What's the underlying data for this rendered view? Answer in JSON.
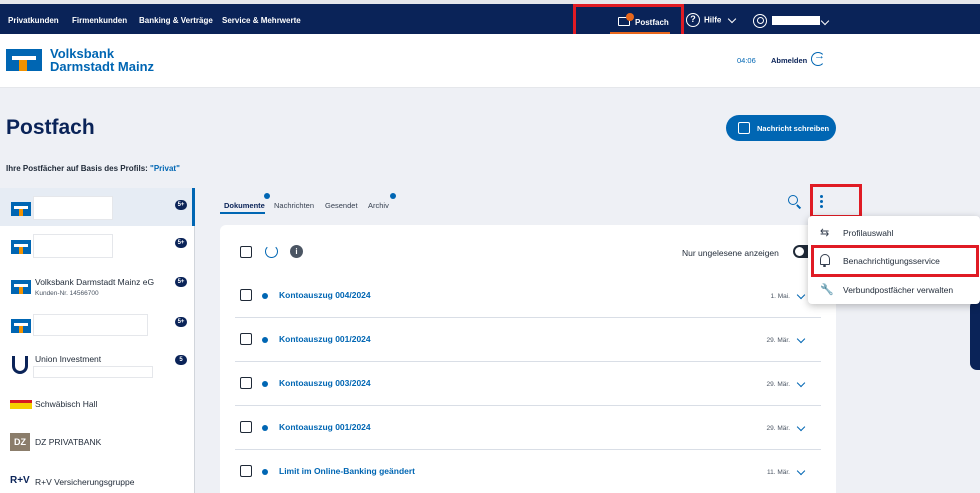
{
  "topnav": {
    "links": [
      "Privatkunden",
      "Firmenkunden",
      "Banking & Verträge",
      "Service & Mehrwerte"
    ],
    "postfach_label": "Postfach",
    "help_label": "Hilfe"
  },
  "header": {
    "bank_name_line1": "Volksbank",
    "bank_name_line2": "Darmstadt Mainz",
    "session_time": "04:06",
    "logout_label": "Abmelden"
  },
  "page": {
    "title": "Postfach",
    "write_button": "Nachricht schreiben",
    "profile_note": "Ihre Postfächer auf Basis des Profils: ",
    "profile_value": "\"Privat\""
  },
  "sidebar": {
    "items": [
      {
        "name": "",
        "sub": "",
        "badge": "5+"
      },
      {
        "name": "",
        "sub": "",
        "badge": "5+"
      },
      {
        "name": "Volksbank Darmstadt Mainz eG",
        "sub": "Kunden-Nr. 14566700",
        "badge": "5+"
      },
      {
        "name": "",
        "sub": "",
        "badge": "5+"
      },
      {
        "name": "Union Investment",
        "sub": "",
        "badge": "5"
      },
      {
        "name": "Schwäbisch Hall",
        "sub": "",
        "badge": ""
      },
      {
        "name": "DZ PRIVATBANK",
        "sub": "",
        "badge": ""
      },
      {
        "name": "R+V Versicherungsgruppe",
        "sub": "",
        "badge": ""
      }
    ],
    "dz_logo_text": "DZ",
    "rv_logo_text": "R+V"
  },
  "tabs": [
    "Dokumente",
    "Nachrichten",
    "Gesendet",
    "Archiv"
  ],
  "toolbar": {
    "unread_label": "Nur ungelesene anzeigen",
    "info_glyph": "i"
  },
  "messages": [
    {
      "title": "Kontoauszug 004/2024",
      "date": "1. Mai."
    },
    {
      "title": "Kontoauszug 001/2024",
      "date": "29. Mär."
    },
    {
      "title": "Kontoauszug 003/2024",
      "date": "29. Mär."
    },
    {
      "title": "Kontoauszug 001/2024",
      "date": "29. Mär."
    },
    {
      "title": "Limit im Online-Banking geändert",
      "date": "11. Mär."
    }
  ],
  "menu": {
    "items": [
      "Profilauswahl",
      "Benachrichtigungsservice",
      "Verbundpostfächer verwalten"
    ]
  },
  "colors": {
    "nav": "#0a2358",
    "brand_blue": "#0066b3",
    "brand_orange": "#f39200",
    "highlight_red": "#e01b24"
  }
}
